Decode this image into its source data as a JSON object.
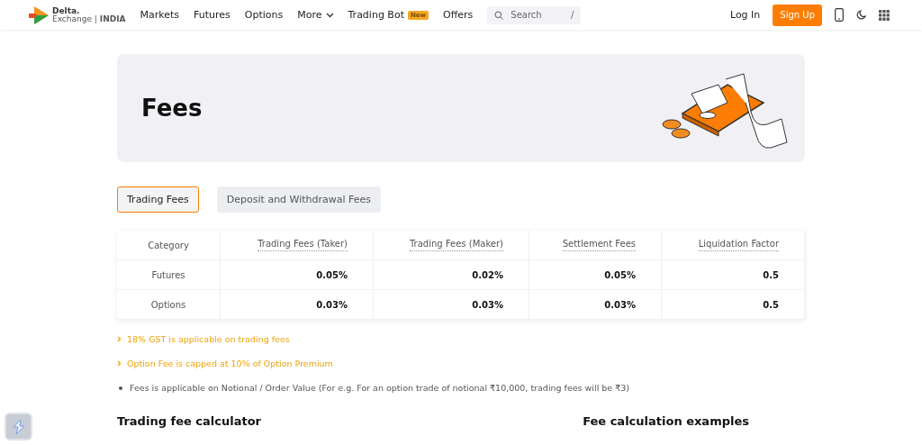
{
  "nav": {
    "logo_top": "Delta.",
    "logo_bottom": "Exchange",
    "logo_separator": "|",
    "logo_region": "INDIA",
    "links": [
      {
        "label": "Markets",
        "kind": "link"
      },
      {
        "label": "Futures",
        "kind": "link"
      },
      {
        "label": "Options",
        "kind": "link"
      },
      {
        "label": "More",
        "kind": "dropdown"
      },
      {
        "label": "Trading Bot",
        "kind": "badge",
        "badge": "New"
      },
      {
        "label": "Offers",
        "kind": "link"
      }
    ],
    "search": {
      "placeholder": "Search",
      "shortcut": "/"
    },
    "login": "Log In",
    "signup": "Sign Up"
  },
  "hero": {
    "title": "Fees"
  },
  "tabs": [
    {
      "label": "Trading Fees",
      "selected": true
    },
    {
      "label": "Deposit and Withdrawal Fees",
      "selected": false
    }
  ],
  "table": {
    "columns": [
      "Category",
      "Trading Fees (Taker)",
      "Trading Fees (Maker)",
      "Settlement Fees",
      "Liquidation Factor"
    ],
    "rows": [
      [
        "Futures",
        "0.05%",
        "0.02%",
        "0.05%",
        "0.5"
      ],
      [
        "Options",
        "0.03%",
        "0.03%",
        "0.03%",
        "0.5"
      ]
    ]
  },
  "notes": [
    {
      "kind": "highlight",
      "text": "18% GST is applicable on trading fees"
    },
    {
      "kind": "highlight",
      "text": "Option Fee is capped at 10% of Option Premium"
    },
    {
      "kind": "bullet",
      "text": "Fees is applicable on Notional / Order Value (For e.g. For an option trade of notional ₹10,000, trading fees will be ₹3)"
    }
  ],
  "sections": [
    "Trading fee calculator",
    "Fee calculation examples"
  ]
}
